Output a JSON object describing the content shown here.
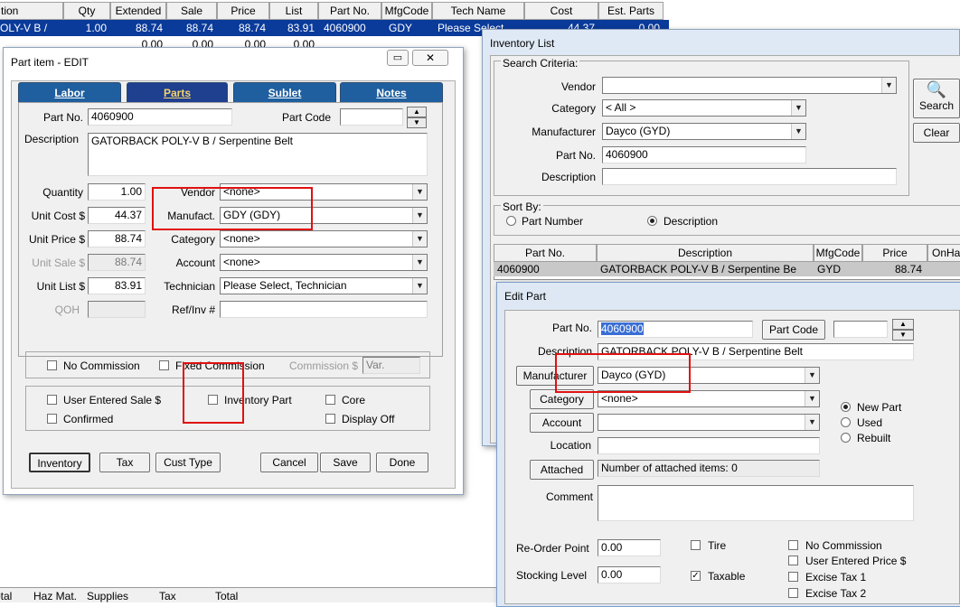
{
  "bg_grid": {
    "headers": [
      "tion",
      "Qty",
      "Extended",
      "Sale",
      "Price",
      "List",
      "Part No.",
      "MfgCode",
      "Tech Name",
      "Cost",
      "Est. Parts"
    ],
    "row1": [
      "OLY-V B /",
      "1.00",
      "88.74",
      "88.74",
      "88.74",
      "83.91",
      "4060900",
      "GDY",
      "Please Select",
      "44.37",
      "0.00"
    ],
    "row2": [
      "",
      "",
      "0.00",
      "0.00",
      "0.00",
      "0.00"
    ],
    "footer": [
      "Total",
      "Haz Mat.",
      "Supplies",
      "Tax",
      "Total"
    ]
  },
  "part_edit": {
    "title": "Part item - EDIT",
    "tabs": [
      "Labor",
      "Parts",
      "Sublet",
      "Notes"
    ],
    "part_no_label": "Part No.",
    "part_no": "4060900",
    "part_code_label": "Part Code",
    "part_code": "",
    "description_label": "Description",
    "description": "GATORBACK POLY-V B / Serpentine Belt",
    "quantity_label": "Quantity",
    "quantity": "1.00",
    "unit_cost_label": "Unit Cost $",
    "unit_cost": "44.37",
    "unit_price_label": "Unit Price $",
    "unit_price": "88.74",
    "unit_sale_label": "Unit Sale $",
    "unit_sale": "88.74",
    "unit_list_label": "Unit List $",
    "unit_list": "83.91",
    "qoh_label": "QOH",
    "vendor_label": "Vendor",
    "vendor": "<none>",
    "manufact_label": "Manufact.",
    "manufact": "GDY (GDY)",
    "category_label": "Category",
    "category": "<none>",
    "account_label": "Account",
    "account": "<none>",
    "technician_label": "Technician",
    "technician": "Please Select, Technician",
    "refinv_label": "Ref/Inv #",
    "no_commission": "No Commission",
    "fixed_commission": "Fixed Commission",
    "commission_label": "Commission $",
    "commission_value": "Var.",
    "user_entered_sale": "User Entered Sale $",
    "inventory_part": "Inventory Part",
    "core": "Core",
    "confirmed": "Confirmed",
    "display_off": "Display Off",
    "buttons": [
      "Inventory",
      "Tax",
      "Cust Type",
      "Cancel",
      "Save",
      "Done"
    ]
  },
  "inventory_list": {
    "title": "Inventory List",
    "search_criteria": "Search Criteria:",
    "vendor_label": "Vendor",
    "vendor": "",
    "category_label": "Category",
    "category": "< All >",
    "manufacturer_label": "Manufacturer",
    "manufacturer": "Dayco (GYD)",
    "part_no_label": "Part No.",
    "part_no": "4060900",
    "description_label": "Description",
    "description": "",
    "search_btn": "Search",
    "clear_btn": "Clear",
    "sort_by": "Sort By:",
    "sort_part_number": "Part Number",
    "sort_description": "Description",
    "grid_headers": [
      "Part No.",
      "Description",
      "MfgCode",
      "Price",
      "OnHa"
    ],
    "grid_row": [
      "4060900",
      "GATORBACK POLY-V B / Serpentine Be",
      "GYD",
      "88.74"
    ]
  },
  "edit_part": {
    "title": "Edit Part",
    "part_no_label": "Part No.",
    "part_no": "4060900",
    "part_code_btn": "Part Code",
    "part_code": "",
    "description_label": "Description",
    "description": "GATORBACK POLY-V B / Serpentine Belt",
    "manufacturer_btn": "Manufacturer",
    "manufacturer": "Dayco (GYD)",
    "category_btn": "Category",
    "category": "<none>",
    "account_btn": "Account",
    "account": "",
    "location_label": "Location",
    "location": "",
    "attached_btn": "Attached",
    "attached_text": "Number of attached items: 0",
    "comment_label": "Comment",
    "new_part": "New Part",
    "used": "Used",
    "rebuilt": "Rebuilt",
    "reorder_label": "Re-Order Point",
    "reorder": "0.00",
    "stocking_label": "Stocking Level",
    "stocking": "0.00",
    "tire": "Tire",
    "taxable": "Taxable",
    "no_commission": "No Commission",
    "user_entered_price": "User Entered Price $",
    "excise1": "Excise Tax 1",
    "excise2": "Excise Tax 2"
  }
}
